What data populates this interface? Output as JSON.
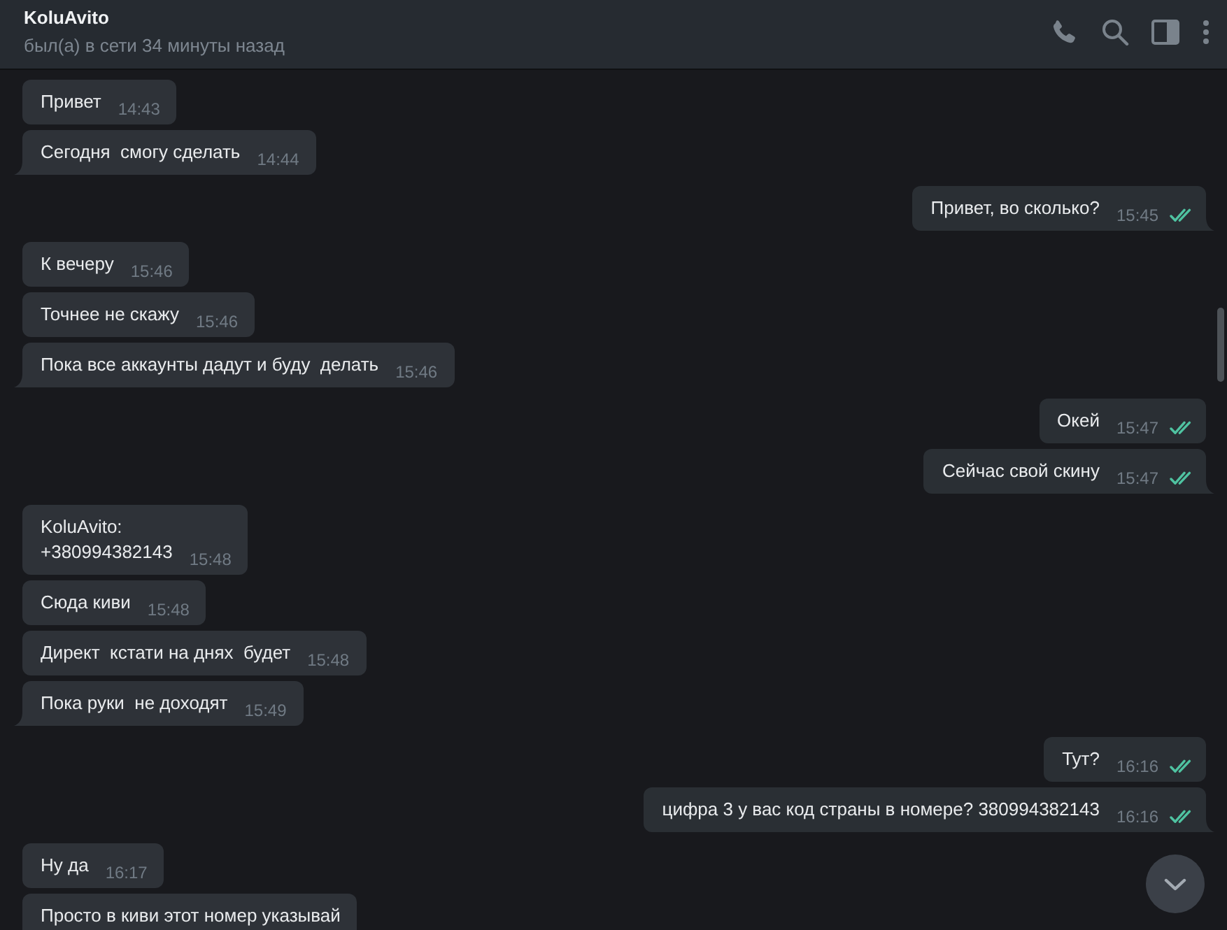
{
  "header": {
    "name": "KoluAvito",
    "status": "был(а) в сети 34 минуты назад"
  },
  "messages": [
    {
      "kind": "incoming",
      "text": "Привет",
      "time": "14:43"
    },
    {
      "kind": "incoming",
      "text": "Сегодня  смогу сделать",
      "time": "14:44"
    },
    {
      "kind": "outgoing",
      "text": "Привет, во сколько?",
      "time": "15:45",
      "read": true
    },
    {
      "kind": "incoming",
      "text": "К вечеру",
      "time": "15:46"
    },
    {
      "kind": "incoming",
      "text": "Точнее не скажу",
      "time": "15:46"
    },
    {
      "kind": "incoming",
      "text": "Пока все аккаунты дадут и буду  делать",
      "time": "15:46"
    },
    {
      "kind": "outgoing",
      "text": "Окей",
      "time": "15:47",
      "read": true
    },
    {
      "kind": "outgoing",
      "text": "Сейчас свой скину",
      "time": "15:47",
      "read": true
    },
    {
      "kind": "incoming",
      "text": "KoluAvito:\n+380994382143",
      "time": "15:48"
    },
    {
      "kind": "incoming",
      "text": "Сюда киви",
      "time": "15:48"
    },
    {
      "kind": "incoming",
      "text": "Директ  кстати на днях  будет",
      "time": "15:48"
    },
    {
      "kind": "incoming",
      "text": "Пока руки  не доходят",
      "time": "15:49"
    },
    {
      "kind": "outgoing",
      "text": "Тут?",
      "time": "16:16",
      "read": true
    },
    {
      "kind": "outgoing",
      "text": "цифра 3 у вас код страны в номере? 380994382143",
      "time": "16:16",
      "read": true
    },
    {
      "kind": "incoming",
      "text": "Ну да",
      "time": "16:17"
    },
    {
      "kind": "incoming",
      "text": "Просто в киви этот номер указывай"
    }
  ]
}
